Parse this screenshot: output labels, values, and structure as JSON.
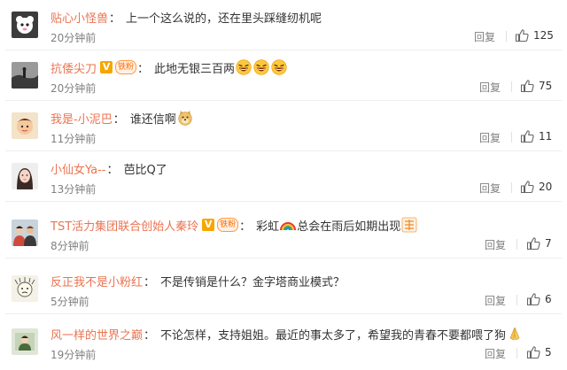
{
  "comments": [
    {
      "username": "贴心小怪兽",
      "text": "上一个这么说的，还在里头踩缝纫机呢",
      "time": "20分钟前",
      "reply_label": "回复",
      "likes": "125"
    },
    {
      "username": "抗倭尖刀",
      "badge_v": "V",
      "badge_tag": "铁粉",
      "text": "此地无银三百两",
      "emoji": "laughing-face-emoji",
      "time": "20分钟前",
      "reply_label": "回复",
      "likes": "75"
    },
    {
      "username": "我是-小泥巴",
      "text": "谁还信啊",
      "emoji": "doge-emoji",
      "time": "11分钟前",
      "reply_label": "回复",
      "likes": "11"
    },
    {
      "username": "小仙女Ya--",
      "text": "芭比Q了",
      "time": "13分钟前",
      "reply_label": "回复",
      "likes": "20"
    },
    {
      "username": "TST活力集团联合创始人秦玲",
      "badge_v": "V",
      "badge_tag": "铁粉",
      "text_a": "彩虹",
      "text_b": "总会在雨后如期出现",
      "time": "8分钟前",
      "reply_label": "回复",
      "likes": "7"
    },
    {
      "username": "反正我不是小粉红",
      "text": "不是传销是什么？金字塔商业模式？",
      "time": "5分钟前",
      "reply_label": "回复",
      "likes": "6"
    },
    {
      "username": "风一样的世界之巅",
      "text": "不论怎样，支持姐姐。最近的事太多了，希望我的青春不要都喂了狗",
      "time": "19分钟前",
      "reply_label": "回复",
      "likes": "5"
    }
  ],
  "colors": {
    "username": "#eb7350",
    "meta": "#808080",
    "text": "#333333",
    "divider": "#eeeeee"
  }
}
